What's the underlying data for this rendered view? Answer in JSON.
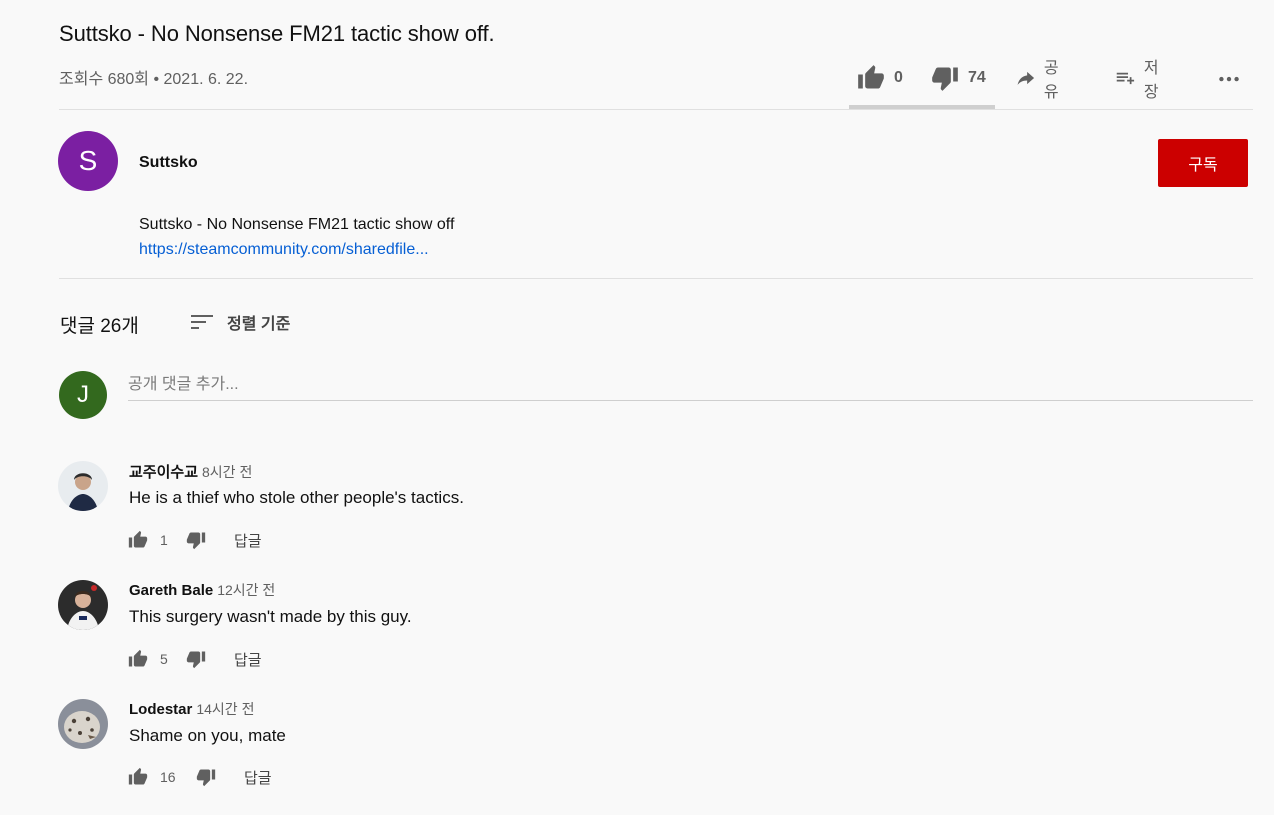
{
  "video": {
    "title": "Suttsko - No Nonsense FM21 tactic show off.",
    "meta": "조회수 680회 • 2021. 6. 22.",
    "likes": "0",
    "dislikes": "74",
    "share_label": "공유",
    "save_label": "저장"
  },
  "channel": {
    "avatar_letter": "S",
    "avatar_color": "#7b1fa2",
    "name": "Suttsko",
    "subscribe_label": "구독",
    "subscribe_color": "#cc0000"
  },
  "description": {
    "text": "Suttsko - No Nonsense FM21 tactic show off",
    "link": "https://steamcommunity.com/sharedfile..."
  },
  "comments_section": {
    "count_label": "댓글 26개",
    "sort_label": "정렬 기준",
    "my_avatar_letter": "J",
    "my_avatar_color": "#33691e",
    "input_placeholder": "공개 댓글 추가..."
  },
  "comments": [
    {
      "author": "교주이수교",
      "time": "8시간 전",
      "text": "He is a thief who stole other people's tactics.",
      "likes": "1",
      "reply_label": "답글"
    },
    {
      "author": "Gareth Bale",
      "time": "12시간 전",
      "text": "This surgery wasn't made by this guy.",
      "likes": "5",
      "reply_label": "답글"
    },
    {
      "author": "Lodestar",
      "time": "14시간 전",
      "text": "Shame on you, mate",
      "likes": "16",
      "reply_label": "답글"
    }
  ]
}
